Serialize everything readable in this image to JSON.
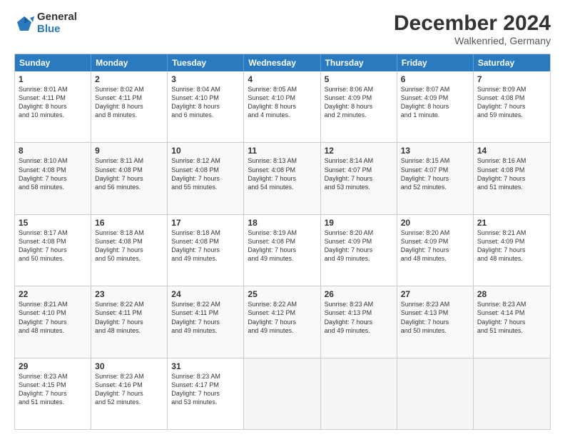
{
  "logo": {
    "general": "General",
    "blue": "Blue"
  },
  "header": {
    "title": "December 2024",
    "subtitle": "Walkenried, Germany"
  },
  "calendar": {
    "days": [
      "Sunday",
      "Monday",
      "Tuesday",
      "Wednesday",
      "Thursday",
      "Friday",
      "Saturday"
    ],
    "weeks": [
      [
        {
          "day": "",
          "data": ""
        },
        {
          "day": "2",
          "data": "Sunrise: 8:02 AM\nSunset: 4:11 PM\nDaylight: 8 hours\nand 8 minutes."
        },
        {
          "day": "3",
          "data": "Sunrise: 8:04 AM\nSunset: 4:10 PM\nDaylight: 8 hours\nand 6 minutes."
        },
        {
          "day": "4",
          "data": "Sunrise: 8:05 AM\nSunset: 4:10 PM\nDaylight: 8 hours\nand 4 minutes."
        },
        {
          "day": "5",
          "data": "Sunrise: 8:06 AM\nSunset: 4:09 PM\nDaylight: 8 hours\nand 2 minutes."
        },
        {
          "day": "6",
          "data": "Sunrise: 8:07 AM\nSunset: 4:09 PM\nDaylight: 8 hours\nand 1 minute."
        },
        {
          "day": "7",
          "data": "Sunrise: 8:09 AM\nSunset: 4:08 PM\nDaylight: 7 hours\nand 59 minutes."
        }
      ],
      [
        {
          "day": "8",
          "data": "Sunrise: 8:10 AM\nSunset: 4:08 PM\nDaylight: 7 hours\nand 58 minutes."
        },
        {
          "day": "9",
          "data": "Sunrise: 8:11 AM\nSunset: 4:08 PM\nDaylight: 7 hours\nand 56 minutes."
        },
        {
          "day": "10",
          "data": "Sunrise: 8:12 AM\nSunset: 4:08 PM\nDaylight: 7 hours\nand 55 minutes."
        },
        {
          "day": "11",
          "data": "Sunrise: 8:13 AM\nSunset: 4:08 PM\nDaylight: 7 hours\nand 54 minutes."
        },
        {
          "day": "12",
          "data": "Sunrise: 8:14 AM\nSunset: 4:07 PM\nDaylight: 7 hours\nand 53 minutes."
        },
        {
          "day": "13",
          "data": "Sunrise: 8:15 AM\nSunset: 4:07 PM\nDaylight: 7 hours\nand 52 minutes."
        },
        {
          "day": "14",
          "data": "Sunrise: 8:16 AM\nSunset: 4:08 PM\nDaylight: 7 hours\nand 51 minutes."
        }
      ],
      [
        {
          "day": "15",
          "data": "Sunrise: 8:17 AM\nSunset: 4:08 PM\nDaylight: 7 hours\nand 50 minutes."
        },
        {
          "day": "16",
          "data": "Sunrise: 8:18 AM\nSunset: 4:08 PM\nDaylight: 7 hours\nand 50 minutes."
        },
        {
          "day": "17",
          "data": "Sunrise: 8:18 AM\nSunset: 4:08 PM\nDaylight: 7 hours\nand 49 minutes."
        },
        {
          "day": "18",
          "data": "Sunrise: 8:19 AM\nSunset: 4:08 PM\nDaylight: 7 hours\nand 49 minutes."
        },
        {
          "day": "19",
          "data": "Sunrise: 8:20 AM\nSunset: 4:09 PM\nDaylight: 7 hours\nand 49 minutes."
        },
        {
          "day": "20",
          "data": "Sunrise: 8:20 AM\nSunset: 4:09 PM\nDaylight: 7 hours\nand 48 minutes."
        },
        {
          "day": "21",
          "data": "Sunrise: 8:21 AM\nSunset: 4:09 PM\nDaylight: 7 hours\nand 48 minutes."
        }
      ],
      [
        {
          "day": "22",
          "data": "Sunrise: 8:21 AM\nSunset: 4:10 PM\nDaylight: 7 hours\nand 48 minutes."
        },
        {
          "day": "23",
          "data": "Sunrise: 8:22 AM\nSunset: 4:11 PM\nDaylight: 7 hours\nand 48 minutes."
        },
        {
          "day": "24",
          "data": "Sunrise: 8:22 AM\nSunset: 4:11 PM\nDaylight: 7 hours\nand 49 minutes."
        },
        {
          "day": "25",
          "data": "Sunrise: 8:22 AM\nSunset: 4:12 PM\nDaylight: 7 hours\nand 49 minutes."
        },
        {
          "day": "26",
          "data": "Sunrise: 8:23 AM\nSunset: 4:13 PM\nDaylight: 7 hours\nand 49 minutes."
        },
        {
          "day": "27",
          "data": "Sunrise: 8:23 AM\nSunset: 4:13 PM\nDaylight: 7 hours\nand 50 minutes."
        },
        {
          "day": "28",
          "data": "Sunrise: 8:23 AM\nSunset: 4:14 PM\nDaylight: 7 hours\nand 51 minutes."
        }
      ],
      [
        {
          "day": "29",
          "data": "Sunrise: 8:23 AM\nSunset: 4:15 PM\nDaylight: 7 hours\nand 51 minutes."
        },
        {
          "day": "30",
          "data": "Sunrise: 8:23 AM\nSunset: 4:16 PM\nDaylight: 7 hours\nand 52 minutes."
        },
        {
          "day": "31",
          "data": "Sunrise: 8:23 AM\nSunset: 4:17 PM\nDaylight: 7 hours\nand 53 minutes."
        },
        {
          "day": "",
          "data": ""
        },
        {
          "day": "",
          "data": ""
        },
        {
          "day": "",
          "data": ""
        },
        {
          "day": "",
          "data": ""
        }
      ]
    ],
    "week1_day1": {
      "day": "1",
      "data": "Sunrise: 8:01 AM\nSunset: 4:11 PM\nDaylight: 8 hours\nand 10 minutes."
    }
  }
}
